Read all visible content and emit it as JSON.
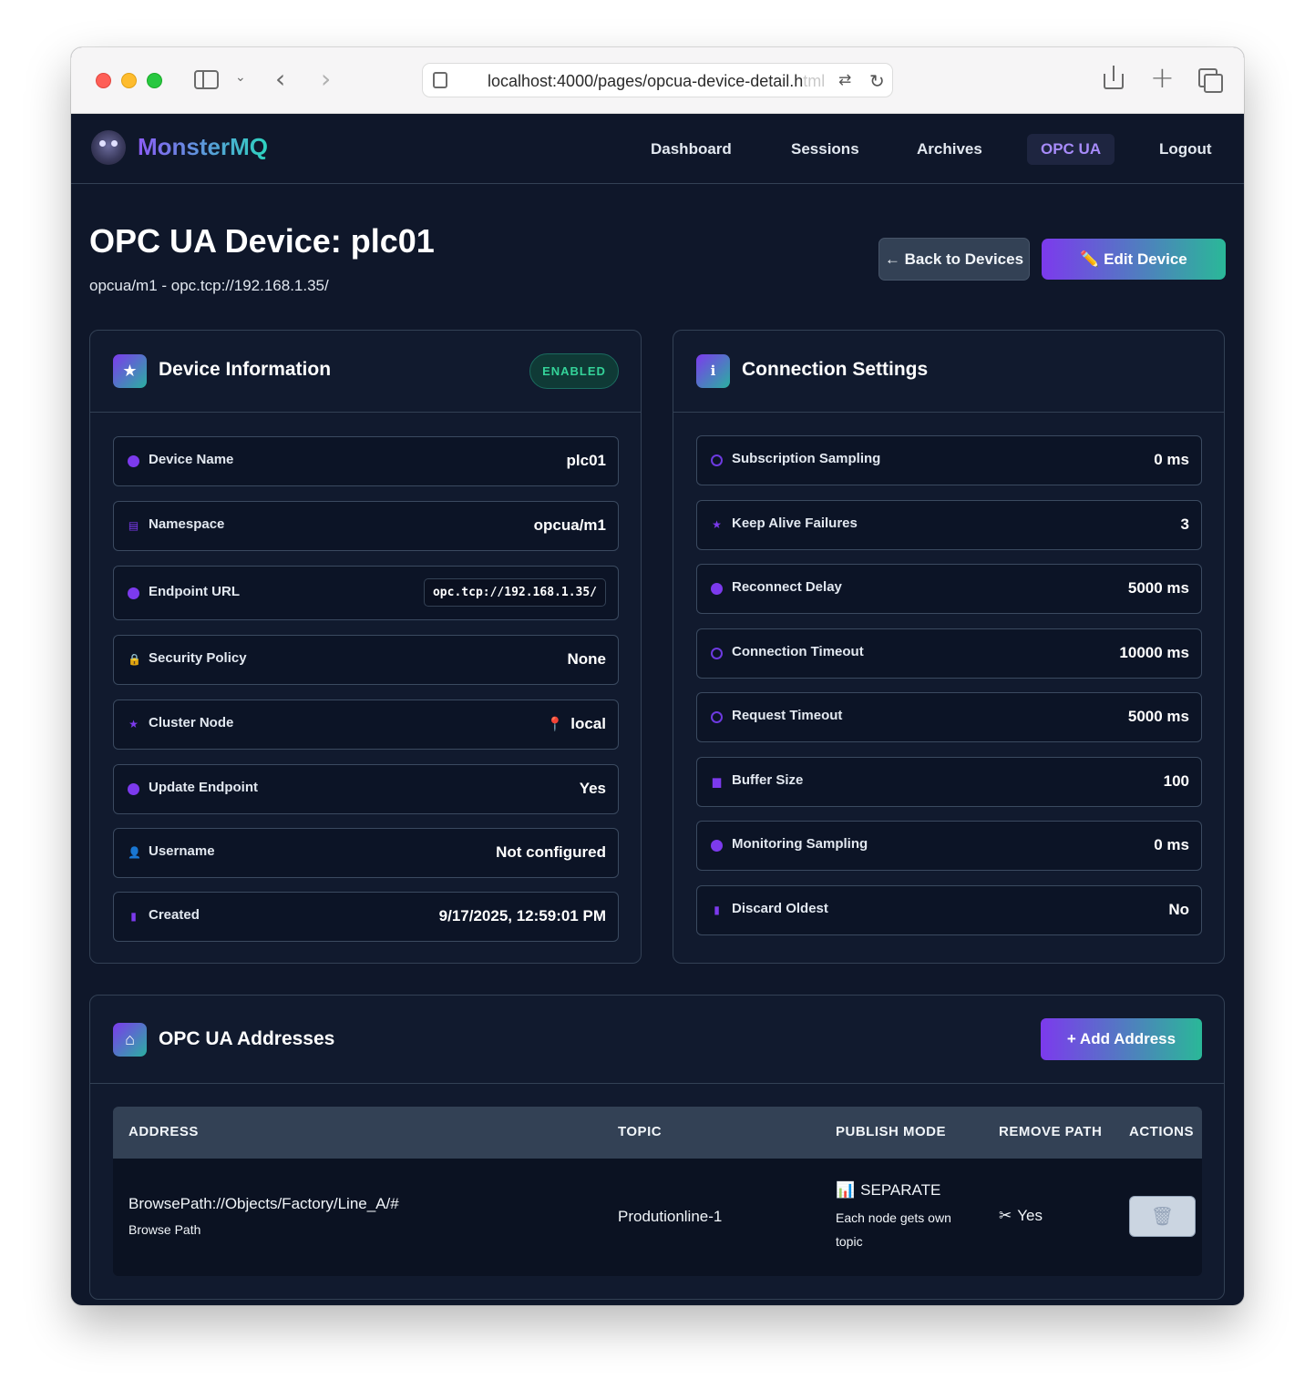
{
  "browser": {
    "url_visible": "localhost:4000/pages/opcua-device-detail.h",
    "url_faded": "tml"
  },
  "navbar": {
    "brand": "MonsterMQ",
    "links": [
      {
        "label": "Dashboard",
        "active": false
      },
      {
        "label": "Sessions",
        "active": false
      },
      {
        "label": "Archives",
        "active": false
      },
      {
        "label": "OPC UA",
        "active": true
      },
      {
        "label": "Logout",
        "active": false
      }
    ]
  },
  "header": {
    "title": "OPC UA Device: plc01",
    "subtitle": "opcua/m1 - opc.tcp://192.168.1.35/",
    "back_label": "← Back to Devices",
    "edit_label": "✏️ Edit Device"
  },
  "device_info": {
    "title": "Device Information",
    "badge": "ENABLED",
    "rows": [
      {
        "label": "Device Name",
        "value": "plc01",
        "icon": "check-circle-icon"
      },
      {
        "label": "Namespace",
        "value": "opcua/m1",
        "icon": "document-icon"
      },
      {
        "label": "Endpoint URL",
        "value": "opc.tcp://192.168.1.35/",
        "icon": "check-circle-icon"
      },
      {
        "label": "Security Policy",
        "value": "None",
        "icon": "lock-icon"
      },
      {
        "label": "Cluster Node",
        "value": "local",
        "icon": "star-icon"
      },
      {
        "label": "Update Endpoint",
        "value": "Yes",
        "icon": "circle-icon"
      },
      {
        "label": "Username",
        "value": "Not configured",
        "icon": "user-icon"
      },
      {
        "label": "Created",
        "value": "9/17/2025, 12:59:01 PM",
        "icon": "bookmark-icon"
      }
    ]
  },
  "connection": {
    "title": "Connection Settings",
    "rows": [
      {
        "label": "Subscription Sampling",
        "value": "0 ms",
        "icon": "ring-icon"
      },
      {
        "label": "Keep Alive Failures",
        "value": "3",
        "icon": "star-icon"
      },
      {
        "label": "Reconnect Delay",
        "value": "5000 ms",
        "icon": "info-icon"
      },
      {
        "label": "Connection Timeout",
        "value": "10000 ms",
        "icon": "ring-icon"
      },
      {
        "label": "Request Timeout",
        "value": "5000 ms",
        "icon": "ring-icon"
      },
      {
        "label": "Buffer Size",
        "value": "100",
        "icon": "stack-icon"
      },
      {
        "label": "Monitoring Sampling",
        "value": "0 ms",
        "icon": "check-circle-icon"
      },
      {
        "label": "Discard Oldest",
        "value": "No",
        "icon": "trash-icon"
      }
    ]
  },
  "addresses": {
    "title": "OPC UA Addresses",
    "add_label": "+  Add Address",
    "columns": [
      "ADDRESS",
      "TOPIC",
      "PUBLISH MODE",
      "REMOVE PATH",
      "ACTIONS"
    ],
    "rows": [
      {
        "address": "BrowsePath://Objects/Factory/Line_A/#",
        "address_type": "Browse Path",
        "topic": "Produtionline-1",
        "mode": "SEPARATE",
        "mode_desc_1": "Each node gets own",
        "mode_desc_2": "topic",
        "remove_path": "Yes"
      }
    ]
  },
  "colors": {
    "background": "#0f172a",
    "accent_purple": "#7c3aed",
    "accent_teal": "#2ab898",
    "enabled_green": "#34d399"
  }
}
